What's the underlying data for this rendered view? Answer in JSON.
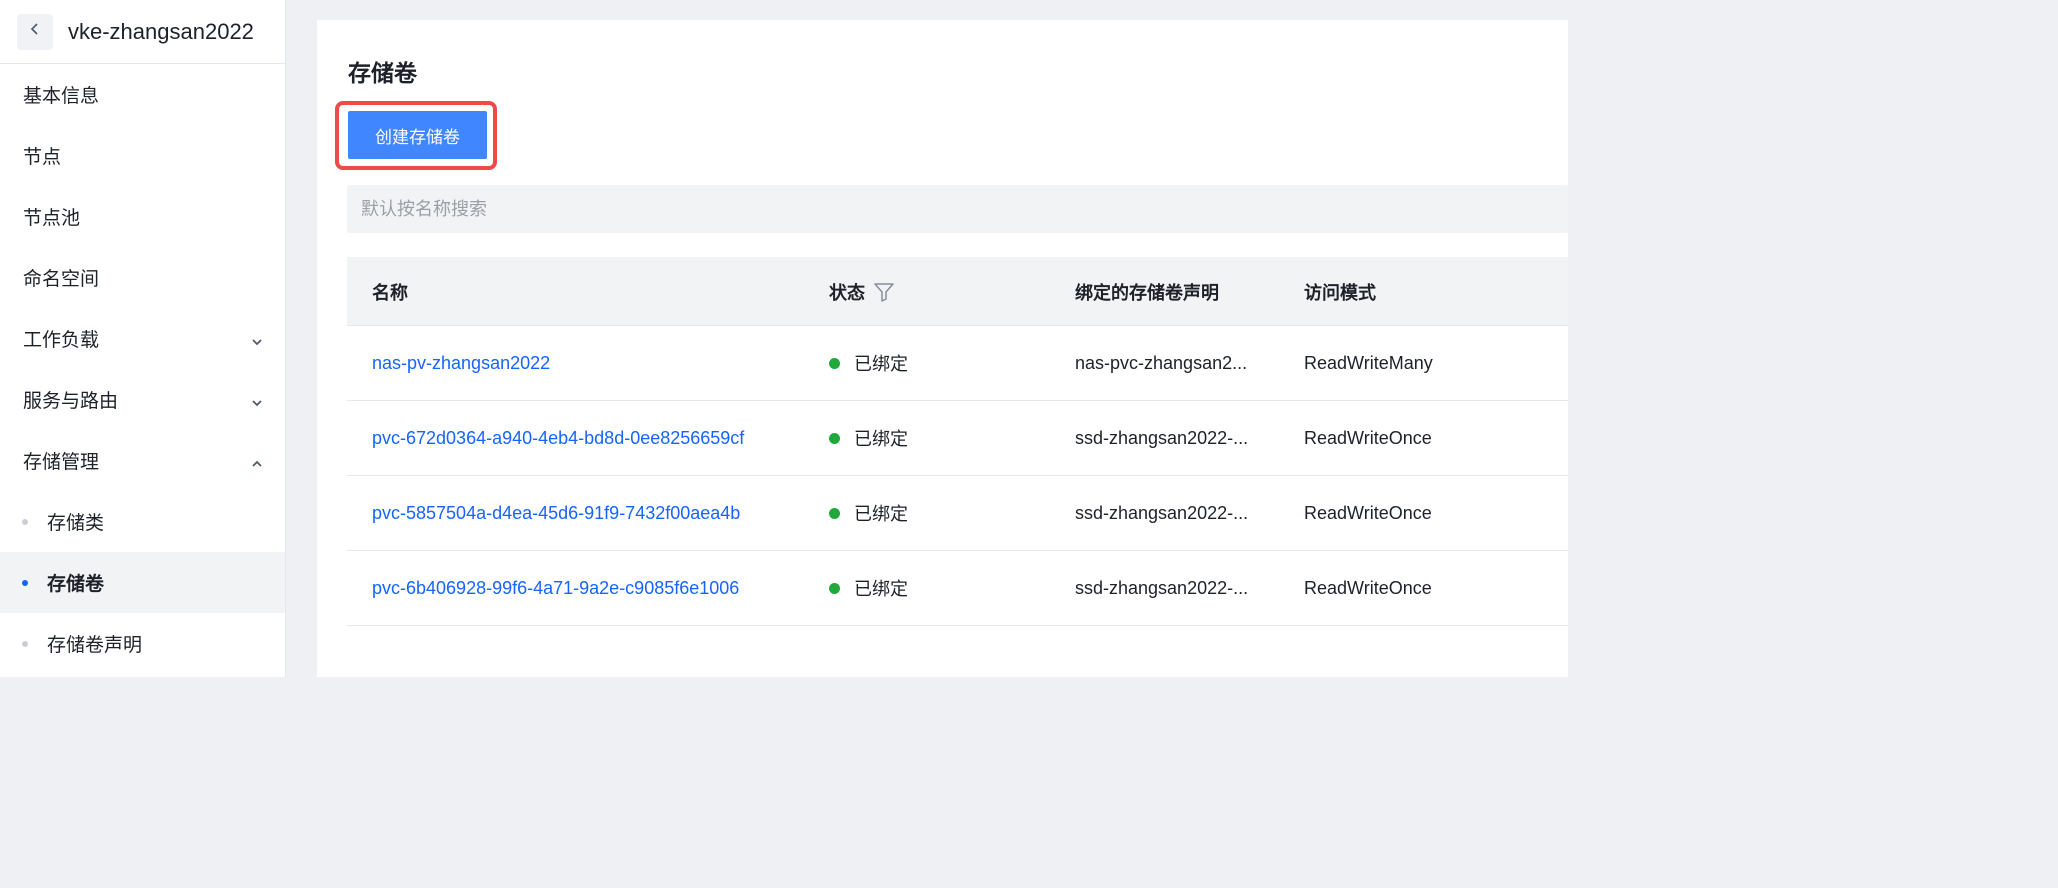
{
  "sidebar": {
    "cluster_name": "vke-zhangsan2022",
    "items": [
      {
        "label": "基本信息"
      },
      {
        "label": "节点"
      },
      {
        "label": "节点池"
      },
      {
        "label": "命名空间"
      },
      {
        "label": "工作负载"
      },
      {
        "label": "服务与路由"
      },
      {
        "label": "存储管理"
      }
    ],
    "sub_items": [
      {
        "label": "存储类"
      },
      {
        "label": "存储卷"
      },
      {
        "label": "存储卷声明"
      }
    ]
  },
  "main": {
    "title": "存储卷",
    "create_button": "创建存储卷",
    "search_placeholder": "默认按名称搜索",
    "columns": {
      "name": "名称",
      "status": "状态",
      "claim": "绑定的存储卷声明",
      "mode": "访问模式"
    },
    "rows": [
      {
        "name": "nas-pv-zhangsan2022",
        "status": "已绑定",
        "claim": "nas-pvc-zhangsan2...",
        "mode": "ReadWriteMany"
      },
      {
        "name": "pvc-672d0364-a940-4eb4-bd8d-0ee8256659cf",
        "status": "已绑定",
        "claim": "ssd-zhangsan2022-...",
        "mode": "ReadWriteOnce"
      },
      {
        "name": "pvc-5857504a-d4ea-45d6-91f9-7432f00aea4b",
        "status": "已绑定",
        "claim": "ssd-zhangsan2022-...",
        "mode": "ReadWriteOnce"
      },
      {
        "name": "pvc-6b406928-99f6-4a71-9a2e-c9085f6e1006",
        "status": "已绑定",
        "claim": "ssd-zhangsan2022-...",
        "mode": "ReadWriteOnce"
      }
    ]
  },
  "colors": {
    "primary": "#4086ff",
    "link": "#1664ff",
    "highlight": "#ef4a4a",
    "status_bound": "#20a83a"
  },
  "icons": {
    "back": "chevron-left-icon",
    "expand": "chevron-down-icon",
    "collapse": "chevron-up-icon",
    "filter": "filter-icon"
  }
}
